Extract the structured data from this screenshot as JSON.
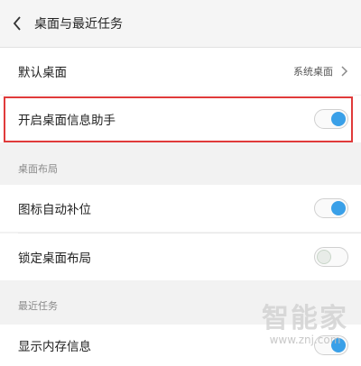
{
  "header": {
    "back_icon": "chevron-left-icon",
    "title": "桌面与最近任务"
  },
  "default_desktop": {
    "label": "默认桌面",
    "value": "系统桌面",
    "chevron_icon": "chevron-right-icon"
  },
  "info_assistant": {
    "label": "开启桌面信息助手",
    "enabled": true
  },
  "section_layout": {
    "title": "桌面布局"
  },
  "icon_autofill": {
    "label": "图标自动补位",
    "enabled": true
  },
  "lock_layout": {
    "label": "锁定桌面布局",
    "enabled": false
  },
  "section_recent": {
    "title": "最近任务"
  },
  "show_memory": {
    "label": "显示内存信息",
    "enabled": true
  },
  "watermark": {
    "brand": "智能家",
    "url": "www.znj.com"
  },
  "colors": {
    "accent": "#3aa0e8",
    "highlight_border": "#e03b3b"
  }
}
